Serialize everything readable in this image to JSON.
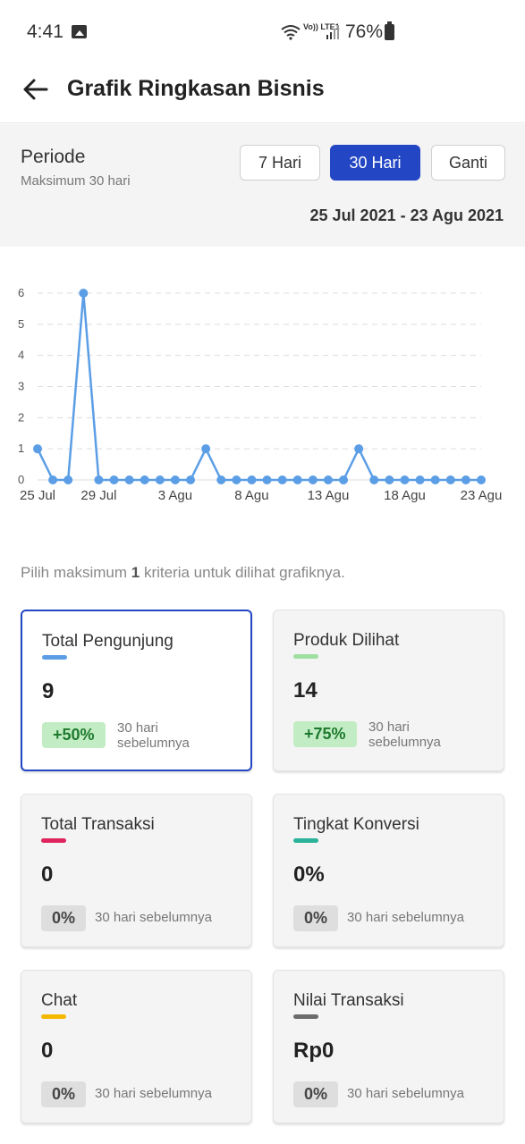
{
  "status_bar": {
    "time": "4:41",
    "lte_label": "Vo)) LTE1",
    "battery": "76%"
  },
  "header": {
    "title": "Grafik Ringkasan Bisnis"
  },
  "period": {
    "label": "Periode",
    "sublabel": "Maksimum 30 hari",
    "buttons": [
      "7 Hari",
      "30 Hari",
      "Ganti"
    ],
    "selected": "30 Hari",
    "date_range": "25 Jul 2021 - 23 Agu 2021"
  },
  "chart_data": {
    "type": "line",
    "x": [
      "25 Jul",
      "26 Jul",
      "27 Jul",
      "28 Jul",
      "29 Jul",
      "30 Jul",
      "31 Jul",
      "1 Agu",
      "2 Agu",
      "3 Agu",
      "4 Agu",
      "5 Agu",
      "6 Agu",
      "7 Agu",
      "8 Agu",
      "9 Agu",
      "10 Agu",
      "11 Agu",
      "12 Agu",
      "13 Agu",
      "14 Agu",
      "15 Agu",
      "16 Agu",
      "17 Agu",
      "18 Agu",
      "19 Agu",
      "20 Agu",
      "21 Agu",
      "22 Agu",
      "23 Agu"
    ],
    "x_tick_labels": [
      "25 Jul",
      "29 Jul",
      "3 Agu",
      "8 Agu",
      "13 Agu",
      "18 Agu",
      "23 Agu"
    ],
    "series": [
      {
        "values": [
          1,
          0,
          0,
          6,
          0,
          0,
          0,
          0,
          0,
          0,
          0,
          1,
          0,
          0,
          0,
          0,
          0,
          0,
          0,
          0,
          0,
          1,
          0,
          0,
          0,
          0,
          0,
          0,
          0,
          0
        ],
        "color": "#5b9ee6"
      }
    ],
    "y_ticks": [
      0,
      1,
      2,
      3,
      4,
      5,
      6
    ],
    "ylim": [
      0,
      6
    ],
    "grid": true
  },
  "hint": {
    "prefix": "Pilih maksimum ",
    "count": "1",
    "suffix": " kriteria untuk dilihat grafiknya."
  },
  "cards": [
    {
      "title": "Total Pengunjung",
      "value": "9",
      "badge": "+50%",
      "compare": "30 hari sebelumnya",
      "color": "#5b9ee6",
      "selected": true
    },
    {
      "title": "Produk Dilihat",
      "value": "14",
      "badge": "+75%",
      "compare": "30 hari sebelumnya",
      "color": "#9fe0a0",
      "selected": false
    },
    {
      "title": "Total Transaksi",
      "value": "0",
      "badge": "0%",
      "compare": "30 hari sebelumnya",
      "color": "#e0245e",
      "selected": false
    },
    {
      "title": "Tingkat Konversi",
      "value": "0%",
      "badge": "0%",
      "compare": "30 hari sebelumnya",
      "color": "#2ab39a",
      "selected": false
    },
    {
      "title": "Chat",
      "value": "0",
      "badge": "0%",
      "compare": "30 hari sebelumnya",
      "color": "#f5b800",
      "selected": false
    },
    {
      "title": "Nilai Transaksi",
      "value": "Rp0",
      "badge": "0%",
      "compare": "30 hari sebelumnya",
      "color": "#6b6b6b",
      "selected": false
    }
  ]
}
